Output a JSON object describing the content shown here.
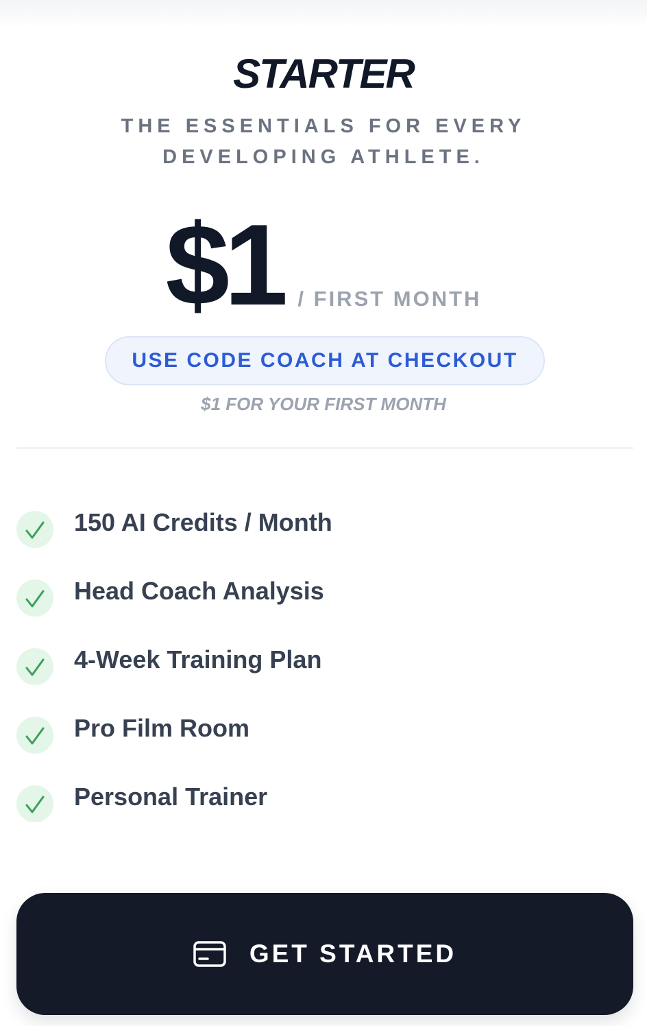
{
  "plan": {
    "name": "STARTER",
    "tagline": "THE ESSENTIALS FOR EVERY DEVELOPING ATHLETE."
  },
  "price": {
    "amount": "$1",
    "period": "/ FIRST MONTH"
  },
  "promo": {
    "code_text": "USE CODE COACH AT CHECKOUT",
    "subtext": "$1 FOR YOUR FIRST MONTH"
  },
  "features": [
    {
      "label": "150 AI Credits / Month",
      "icon": "check-icon"
    },
    {
      "label": "Head Coach Analysis",
      "icon": "check-icon"
    },
    {
      "label": "4-Week Training Plan",
      "icon": "check-icon"
    },
    {
      "label": "Pro Film Room",
      "icon": "check-icon"
    },
    {
      "label": "Personal Trainer",
      "icon": "check-icon"
    }
  ],
  "cta": {
    "label": "GET STARTED",
    "icon": "credit-card-icon"
  },
  "colors": {
    "heading": "#111827",
    "muted": "#6b7280",
    "accent_blue": "#2d5bd4",
    "check_green": "#3e9f5c",
    "cta_background": "#141a28"
  }
}
